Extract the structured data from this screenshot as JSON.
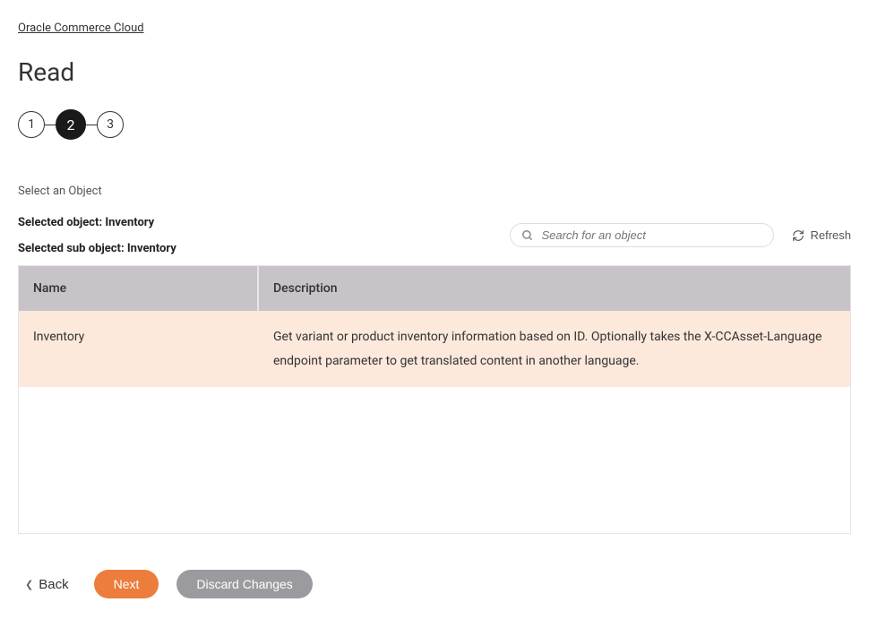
{
  "breadcrumb": {
    "link_text": "Oracle Commerce Cloud"
  },
  "page": {
    "title": "Read"
  },
  "stepper": {
    "steps": [
      "1",
      "2",
      "3"
    ],
    "active_index": 1
  },
  "section": {
    "label": "Select an Object",
    "selected_object_label": "Selected object: Inventory",
    "selected_sub_object_label": "Selected sub object: Inventory"
  },
  "search": {
    "placeholder": "Search for an object"
  },
  "refresh": {
    "label": "Refresh"
  },
  "table": {
    "headers": {
      "name": "Name",
      "description": "Description"
    },
    "rows": [
      {
        "name": "Inventory",
        "description": "Get variant or product inventory information based on ID. Optionally takes the X-CCAsset-Language endpoint parameter to get translated content in another language."
      }
    ]
  },
  "footer": {
    "back": "Back",
    "next": "Next",
    "discard": "Discard Changes"
  }
}
